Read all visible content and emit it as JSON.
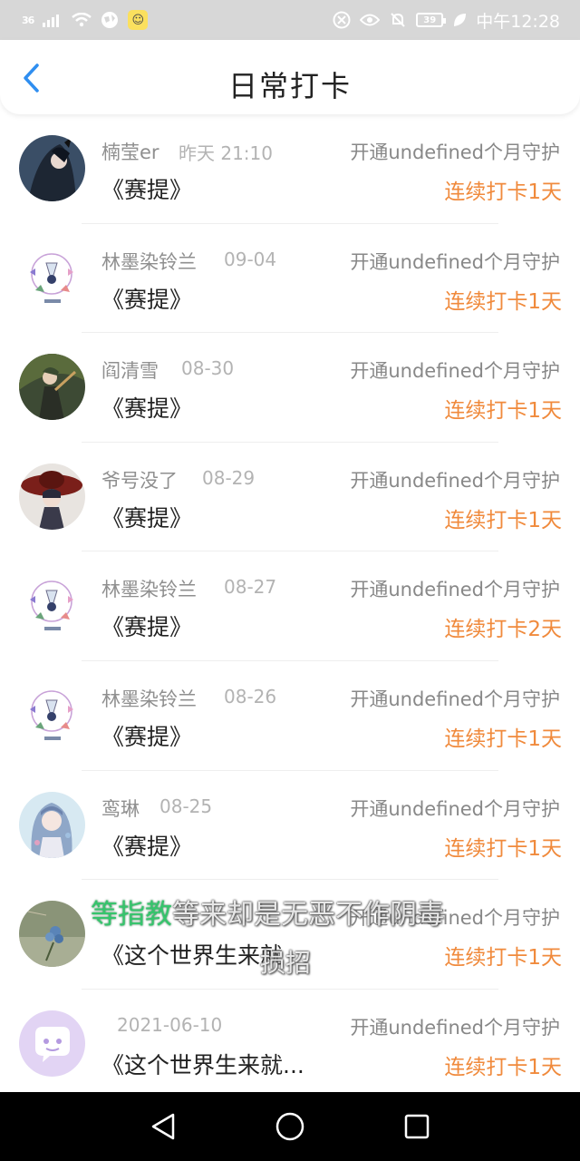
{
  "status_bar": {
    "network": "36",
    "battery": "39",
    "time": "中午12:28"
  },
  "header": {
    "title": "日常打卡"
  },
  "rows": [
    {
      "name": "楠莹er",
      "date": "昨天 21:10",
      "guard": "开通undefined个月守护",
      "book": "《赛提》",
      "streak": "连续打卡1天",
      "avatar": "avatar-dark-character"
    },
    {
      "name": "林墨染铃兰",
      "date": "09-04",
      "guard": "开通undefined个月守护",
      "book": "《赛提》",
      "streak": "连续打卡1天",
      "avatar": "avatar-sky-emblem"
    },
    {
      "name": "阎清雪",
      "date": "08-30",
      "guard": "开通undefined个月守护",
      "book": "《赛提》",
      "streak": "连续打卡1天",
      "avatar": "avatar-forest-character"
    },
    {
      "name": "爷号没了",
      "date": "08-29",
      "guard": "开通undefined个月守护",
      "book": "《赛提》",
      "streak": "连续打卡1天",
      "avatar": "avatar-hat-character"
    },
    {
      "name": "林墨染铃兰",
      "date": "08-27",
      "guard": "开通undefined个月守护",
      "book": "《赛提》",
      "streak": "连续打卡2天",
      "avatar": "avatar-sky-emblem"
    },
    {
      "name": "林墨染铃兰",
      "date": "08-26",
      "guard": "开通undefined个月守护",
      "book": "《赛提》",
      "streak": "连续打卡1天",
      "avatar": "avatar-sky-emblem"
    },
    {
      "name": "鸾琳",
      "date": "08-25",
      "guard": "开通undefined个月守护",
      "book": "《赛提》",
      "streak": "连续打卡1天",
      "avatar": "avatar-anime-girl"
    },
    {
      "name": "",
      "date": "",
      "guard": "开通undefined个月守护",
      "book": "《这个世界生来就",
      "streak": "连续打卡1天",
      "avatar": "avatar-flower-photo"
    },
    {
      "name": "",
      "date": "2021-06-10",
      "guard": "开通undefined个月守护",
      "book": "《这个世界生来就...",
      "streak": "连续打卡1天",
      "avatar": "avatar-default-chat"
    }
  ],
  "subtitle": {
    "highlight": "等指教",
    "rest": "等来却是无恶不作阴毒",
    "line2": "损招"
  },
  "colors": {
    "accent_blue": "#2f8ef0",
    "streak_orange": "#f08a3c",
    "subtitle_green": "#35c56c"
  },
  "nav": {
    "back_icon": "triangle-back-icon",
    "home_icon": "circle-home-icon",
    "recent_icon": "square-recent-icon"
  }
}
